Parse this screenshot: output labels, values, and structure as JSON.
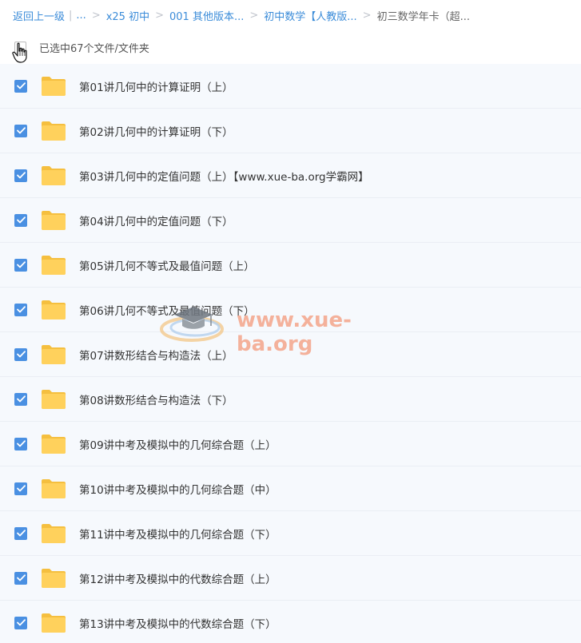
{
  "breadcrumb": {
    "back": "返回上一级",
    "ellipsis": "...",
    "items": [
      "x25 初中",
      "001 其他版本...",
      "初中数学【人教版..."
    ],
    "current": "初三数学年卡（超..."
  },
  "selection": {
    "text": "已选中67个文件/文件夹"
  },
  "files": [
    {
      "name": "第01讲几何中的计算证明（上）"
    },
    {
      "name": "第02讲几何中的计算证明（下）"
    },
    {
      "name": "第03讲几何中的定值问题（上）【www.xue-ba.org学霸网】"
    },
    {
      "name": "第04讲几何中的定值问题（下）"
    },
    {
      "name": "第05讲几何不等式及最值问题（上）"
    },
    {
      "name": "第06讲几何不等式及最值问题（下）"
    },
    {
      "name": "第07讲数形结合与构造法（上）"
    },
    {
      "name": "第08讲数形结合与构造法（下）"
    },
    {
      "name": "第09讲中考及模拟中的几何综合题（上）"
    },
    {
      "name": "第10讲中考及模拟中的几何综合题（中）"
    },
    {
      "name": "第11讲中考及模拟中的几何综合题（下）"
    },
    {
      "name": "第12讲中考及模拟中的代数综合题（上）"
    },
    {
      "name": "第13讲中考及模拟中的代数综合题（下）"
    }
  ],
  "watermark": {
    "text": "www.xue-ba.org"
  },
  "colors": {
    "link": "#3b8cd9",
    "checkbox": "#4a90e2",
    "folder": "#ffd15c",
    "row_bg": "#f6f9fd",
    "watermark": "#f4a58a"
  }
}
